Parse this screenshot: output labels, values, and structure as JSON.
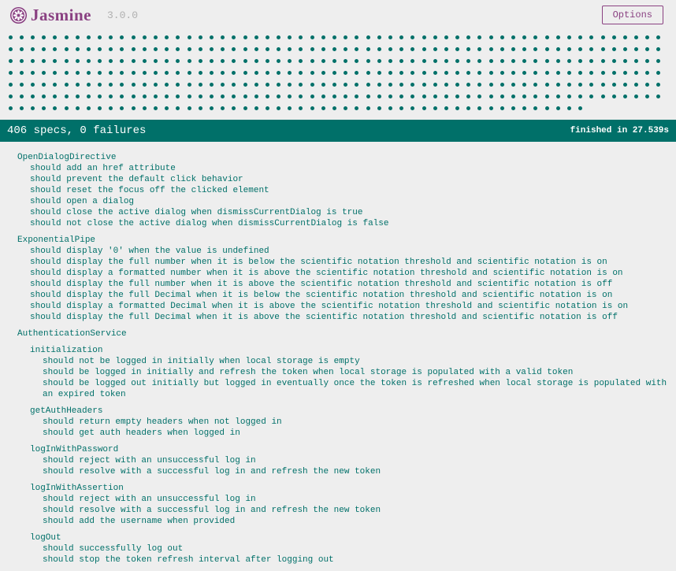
{
  "colors": {
    "accent_purple": "#8a4182",
    "teal": "#007069",
    "page_bg": "#eeeeee",
    "banner_text": "#ffffff",
    "version_gray": "#b0b0b0"
  },
  "header": {
    "brand": "Jasmine",
    "version": "3.0.0",
    "options_label": "Options",
    "logo_icon": "jasmine-flower-icon"
  },
  "dots": {
    "count": 406,
    "status": "passed"
  },
  "banner": {
    "summary": "406 specs, 0 failures",
    "duration": "finished in 27.539s"
  },
  "suites": [
    {
      "name": "OpenDialogDirective",
      "specs": [
        "should add an href attribute",
        "should prevent the default click behavior",
        "should reset the focus off the clicked element",
        "should open a dialog",
        "should close the active dialog when dismissCurrentDialog is true",
        "should not close the active dialog when dismissCurrentDialog is false"
      ]
    },
    {
      "name": "ExponentialPipe",
      "specs": [
        "should display '0' when the value is undefined",
        "should display the full number when it is below the scientific notation threshold and scientific notation is on",
        "should display a formatted number when it is above the scientific notation threshold and scientific notation is on",
        "should display the full number when it is above the scientific notation threshold and scientific notation is off",
        "should display the full Decimal when it is below the scientific notation threshold and scientific notation is on",
        "should display a formatted Decimal when it is above the scientific notation threshold and scientific notation is on",
        "should display the full Decimal when it is above the scientific notation threshold and scientific notation is off"
      ]
    },
    {
      "name": "AuthenticationService",
      "specs": [],
      "children": [
        {
          "name": "initialization",
          "specs": [
            "should not be logged in initially when local storage is empty",
            "should be logged in initially and refresh the token when local storage is populated with a valid token",
            "should be logged out initially but logged in eventually once the token is refreshed when local storage is populated with an expired token"
          ]
        },
        {
          "name": "getAuthHeaders",
          "specs": [
            "should return empty headers when not logged in",
            "should get auth headers when logged in"
          ]
        },
        {
          "name": "logInWithPassword",
          "specs": [
            "should reject with an unsuccessful log in",
            "should resolve with a successful log in and refresh the new token"
          ]
        },
        {
          "name": "logInWithAssertion",
          "specs": [
            "should reject with an unsuccessful log in",
            "should resolve with a successful log in and refresh the new token",
            "should add the username when provided"
          ]
        },
        {
          "name": "logOut",
          "specs": [
            "should successfully log out",
            "should stop the token refresh interval after logging out"
          ]
        }
      ]
    }
  ]
}
